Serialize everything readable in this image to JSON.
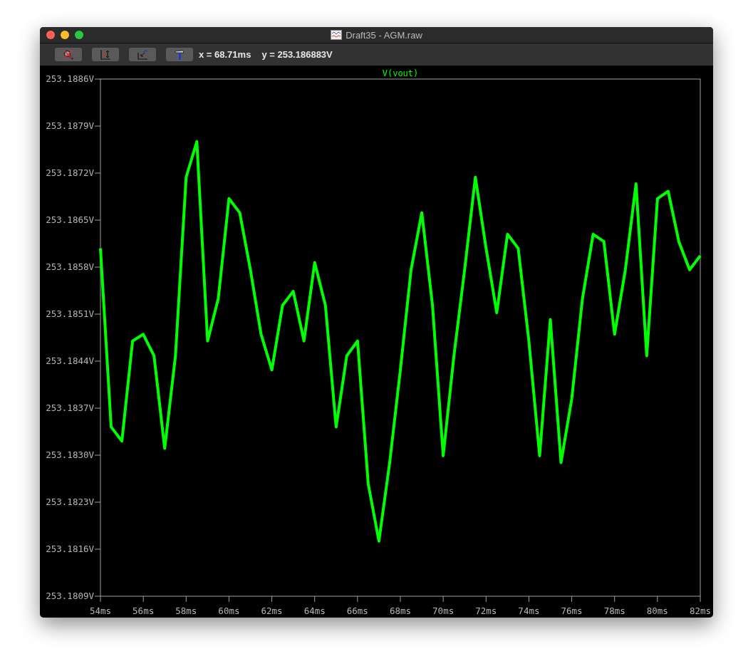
{
  "window": {
    "title": "Draft35 - AGM.raw"
  },
  "toolbar": {
    "buttons": [
      {
        "kind": "zoom-cancel"
      },
      {
        "kind": "autorange-y"
      },
      {
        "kind": "zoom-back"
      },
      {
        "kind": "hammer"
      }
    ],
    "readout_x": "x = 68.71ms",
    "readout_y": "y = 253.186883V"
  },
  "plot": {
    "chart_data": {
      "type": "line",
      "title": "V(vout)",
      "xlim": [
        54,
        82
      ],
      "ylim": [
        253.1809,
        253.1886
      ],
      "xticks": [
        {
          "value": 54,
          "label": "54ms"
        },
        {
          "value": 56,
          "label": "56ms"
        },
        {
          "value": 58,
          "label": "58ms"
        },
        {
          "value": 60,
          "label": "60ms"
        },
        {
          "value": 62,
          "label": "62ms"
        },
        {
          "value": 64,
          "label": "64ms"
        },
        {
          "value": 66,
          "label": "66ms"
        },
        {
          "value": 68,
          "label": "68ms"
        },
        {
          "value": 70,
          "label": "70ms"
        },
        {
          "value": 72,
          "label": "72ms"
        },
        {
          "value": 74,
          "label": "74ms"
        },
        {
          "value": 76,
          "label": "76ms"
        },
        {
          "value": 78,
          "label": "78ms"
        },
        {
          "value": 80,
          "label": "80ms"
        },
        {
          "value": 82,
          "label": "82ms"
        }
      ],
      "yticks": [
        {
          "value": 253.1886,
          "label": "253.1886V"
        },
        {
          "value": 253.1879,
          "label": "253.1879V"
        },
        {
          "value": 253.1872,
          "label": "253.1872V"
        },
        {
          "value": 253.1865,
          "label": "253.1865V"
        },
        {
          "value": 253.1858,
          "label": "253.1858V"
        },
        {
          "value": 253.1851,
          "label": "253.1851V"
        },
        {
          "value": 253.1844,
          "label": "253.1844V"
        },
        {
          "value": 253.1837,
          "label": "253.1837V"
        },
        {
          "value": 253.183,
          "label": "253.1830V"
        },
        {
          "value": 253.1823,
          "label": "253.1823V"
        },
        {
          "value": 253.1816,
          "label": "253.1816V"
        },
        {
          "value": 253.1809,
          "label": "253.1809V"
        }
      ],
      "x": [
        54,
        54.5,
        55,
        55.5,
        56,
        56.5,
        57,
        57.5,
        58,
        58.5,
        59,
        59.5,
        60,
        60.5,
        61,
        61.5,
        62,
        62.5,
        63,
        63.5,
        64,
        64.5,
        65,
        65.5,
        66,
        66.5,
        67,
        67.5,
        68,
        68.5,
        69,
        69.5,
        70,
        70.5,
        71,
        71.5,
        72,
        72.5,
        73,
        73.5,
        74,
        74.5,
        75,
        75.5,
        76,
        76.5,
        77,
        77.5,
        78,
        78.5,
        79,
        79.5,
        80,
        80.5,
        81,
        81.5,
        82
      ],
      "series": [
        {
          "color": "#00ff00",
          "values": [
            253.18608,
            253.18342,
            253.18321,
            253.1847,
            253.1848,
            253.18448,
            253.1831,
            253.18448,
            253.18714,
            253.18767,
            253.1847,
            253.18533,
            253.18682,
            253.18661,
            253.18576,
            253.1848,
            253.18427,
            253.18523,
            253.18544,
            253.1847,
            253.18587,
            253.18523,
            253.18342,
            253.18448,
            253.1847,
            253.18257,
            253.18172,
            253.18289,
            253.18427,
            253.18576,
            253.18661,
            253.18523,
            253.18299,
            253.18448,
            253.18576,
            253.18714,
            253.18608,
            253.18512,
            253.18629,
            253.18608,
            253.1847,
            253.18299,
            253.18502,
            253.18289,
            253.18384,
            253.18533,
            253.18629,
            253.18618,
            253.1848,
            253.18576,
            253.18704,
            253.18448,
            253.18682,
            253.18693,
            253.18618,
            253.18576,
            253.18597
          ]
        }
      ]
    }
  }
}
